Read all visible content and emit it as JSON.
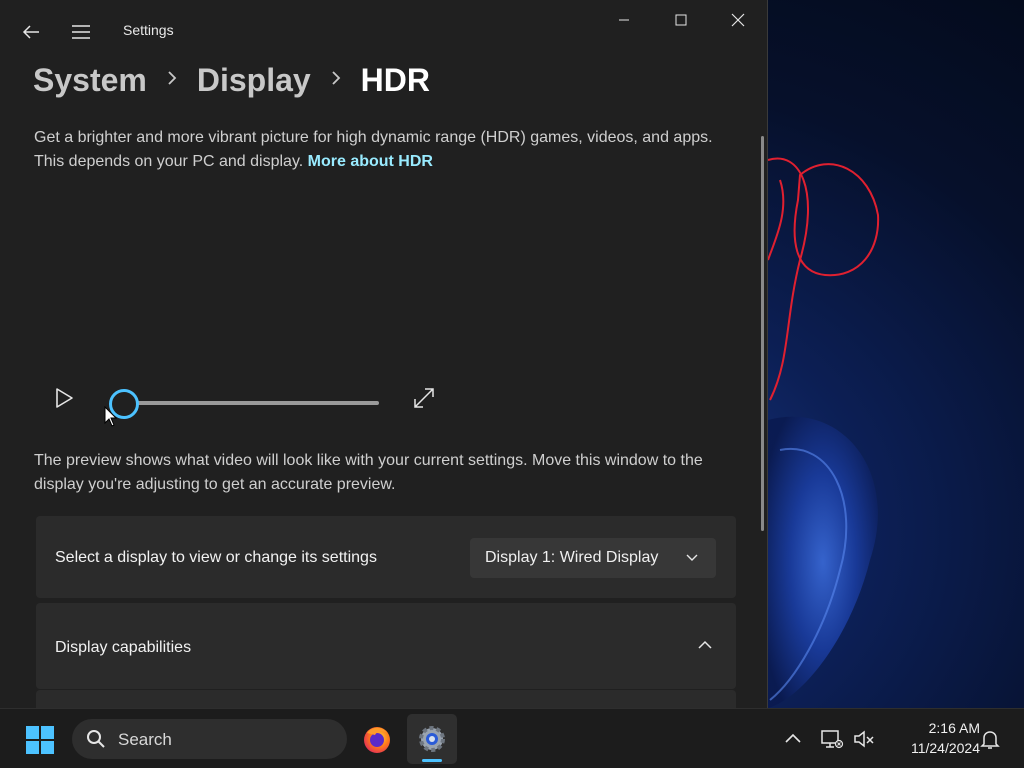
{
  "window": {
    "title": "Settings",
    "controls": {
      "minimize": "minimize",
      "maximize": "maximize",
      "close": "close"
    }
  },
  "breadcrumb": {
    "items": [
      "System",
      "Display",
      "HDR"
    ]
  },
  "intro": {
    "text": "Get a brighter and more vibrant picture for high dynamic range (HDR) games, videos, and apps. This depends on your PC and display. ",
    "link": "More about HDR"
  },
  "player": {
    "progress": 0
  },
  "preview_note": "The preview shows what video will look like with your current settings. Move this window to the display you're adjusting to get an accurate preview.",
  "display_select": {
    "label": "Select a display to view or change its settings",
    "value": "Display 1: Wired Display"
  },
  "capabilities": {
    "label": "Display capabilities",
    "expanded": true
  },
  "taskbar": {
    "search_label": "Search",
    "apps": [
      "firefox-icon",
      "settings-icon"
    ],
    "clock_time": "2:16 AM",
    "clock_date": "11/24/2024"
  },
  "colors": {
    "accent": "#4cc2ff",
    "link": "#99ebff",
    "window_bg": "#202020",
    "card_bg": "#2b2b2b"
  }
}
